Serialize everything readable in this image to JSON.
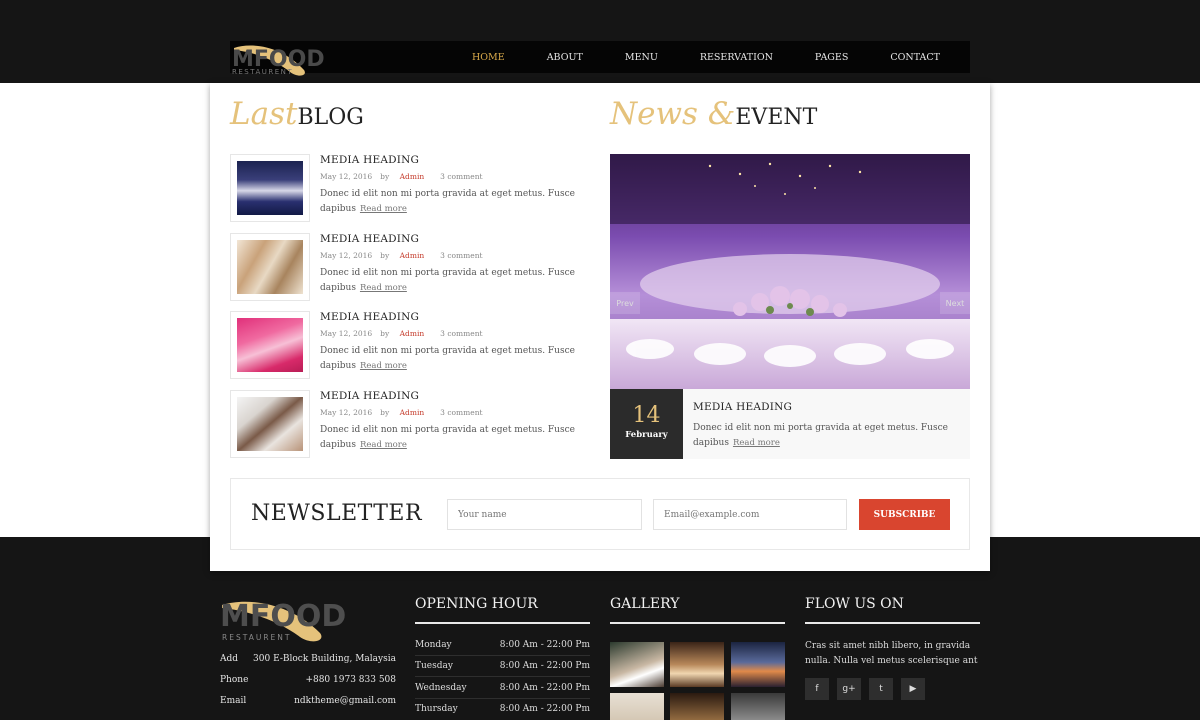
{
  "brand": {
    "logo_word": "MFOOD",
    "logo_sub": "RESTAURENT"
  },
  "nav": {
    "items": [
      {
        "label": "HOME",
        "active": true
      },
      {
        "label": "ABOUT"
      },
      {
        "label": "MENU"
      },
      {
        "label": "RESERVATION"
      },
      {
        "label": "PAGES"
      },
      {
        "label": "CONTACT"
      }
    ]
  },
  "blog": {
    "title_script": "Last",
    "title_bold": "BLOG",
    "items": [
      {
        "heading": "MEDIA HEADING",
        "date": "May 12, 2016",
        "by": "by",
        "author": "Admin",
        "comments": "3 comment",
        "desc": "Donec id elit non mi porta gravida at eget metus. Fusce dapibus",
        "readmore": "Read more",
        "thumb_icon": "dining-table-photo"
      },
      {
        "heading": "MEDIA HEADING",
        "date": "May 12, 2016",
        "by": "by",
        "author": "Admin",
        "comments": "3 comment",
        "desc": "Donec id elit non mi porta gravida at eget metus. Fusce dapibus",
        "readmore": "Read more",
        "thumb_icon": "wine-glasses-photo"
      },
      {
        "heading": "MEDIA HEADING",
        "date": "May 12, 2016",
        "by": "by",
        "author": "Admin",
        "comments": "3 comment",
        "desc": "Donec id elit non mi porta gravida at eget metus. Fusce dapibus",
        "readmore": "Read more",
        "thumb_icon": "pink-table-photo"
      },
      {
        "heading": "MEDIA HEADING",
        "date": "May 12, 2016",
        "by": "by",
        "author": "Admin",
        "comments": "3 comment",
        "desc": "Donec id elit non mi porta gravida at eget metus. Fusce dapibus",
        "readmore": "Read more",
        "thumb_icon": "chefs-photo"
      }
    ]
  },
  "event": {
    "title_script": "News &",
    "title_bold": "EVENT",
    "prev_label": "Prev",
    "next_label": "Next",
    "day": "14",
    "month": "February",
    "heading": "MEDIA HEADING",
    "desc": "Donec id elit non mi porta gravida at eget metus. Fusce dapibus",
    "readmore": "Read more"
  },
  "newsletter": {
    "title": "NEWSLETTER",
    "name_placeholder": "Your name",
    "email_placeholder": "Email@example.com",
    "button": "SUBSCRIBE"
  },
  "footer": {
    "contact": [
      {
        "label": "Add",
        "value": "300 E-Block Building, Malaysia"
      },
      {
        "label": "Phone",
        "value": "+880 1973 833 508"
      },
      {
        "label": "Email",
        "value": "ndktheme@gmail.com"
      }
    ],
    "opening": {
      "title": "OPENING HOUR",
      "rows": [
        {
          "day": "Monday",
          "hours": "8:00 Am - 22:00 Pm"
        },
        {
          "day": "Tuesday",
          "hours": "8:00 Am - 22:00 Pm"
        },
        {
          "day": "Wednesday",
          "hours": "8:00 Am - 22:00 Pm"
        },
        {
          "day": "Thursday",
          "hours": "8:00 Am - 22:00 Pm"
        }
      ]
    },
    "gallery": {
      "title": "GALLERY"
    },
    "follow": {
      "title": "FLOW US ON",
      "text": "Cras sit amet nibh libero, in gravida nulla. Nulla vel metus scelerisque ant",
      "social": [
        {
          "glyph": "f",
          "icon": "facebook-icon"
        },
        {
          "glyph": "g+",
          "icon": "google-plus-icon"
        },
        {
          "glyph": "t",
          "icon": "twitter-icon"
        },
        {
          "glyph": "▶",
          "icon": "youtube-icon"
        }
      ]
    }
  },
  "colors": {
    "accent_gold": "#e5c27b",
    "nav_active": "#d8a94a",
    "subscribe": "#d9452f",
    "author": "#c43a2a",
    "dark_bg": "#151515"
  }
}
